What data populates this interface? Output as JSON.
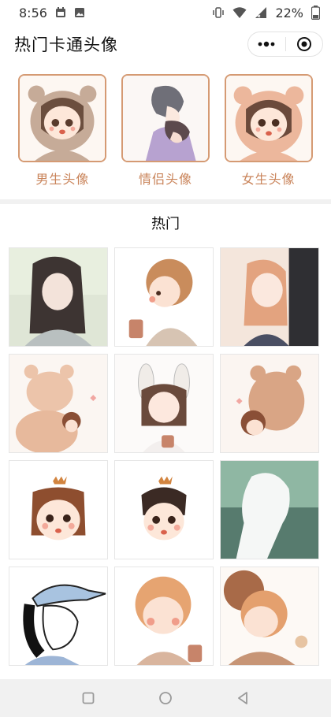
{
  "status_bar": {
    "time": "8:56",
    "battery_percent": "22%",
    "icons": [
      "calendar-icon",
      "image-icon",
      "vibrate-icon",
      "wifi-icon",
      "signal-icon",
      "battery-icon"
    ]
  },
  "header": {
    "title": "热门卡通头像",
    "menu_icon": "more-dots-icon",
    "close_icon": "target-close-icon"
  },
  "categories": [
    {
      "label": "男生头像"
    },
    {
      "label": "情侣头像"
    },
    {
      "label": "女生头像"
    }
  ],
  "section": {
    "title": "热门"
  },
  "colors": {
    "accent": "#c98359",
    "card_border": "#d59a73",
    "divider": "#f1f1f1",
    "navbar": "#f1f1f1"
  },
  "nav_bar": {
    "icons": [
      "recent-apps-icon",
      "home-icon",
      "back-icon"
    ]
  }
}
